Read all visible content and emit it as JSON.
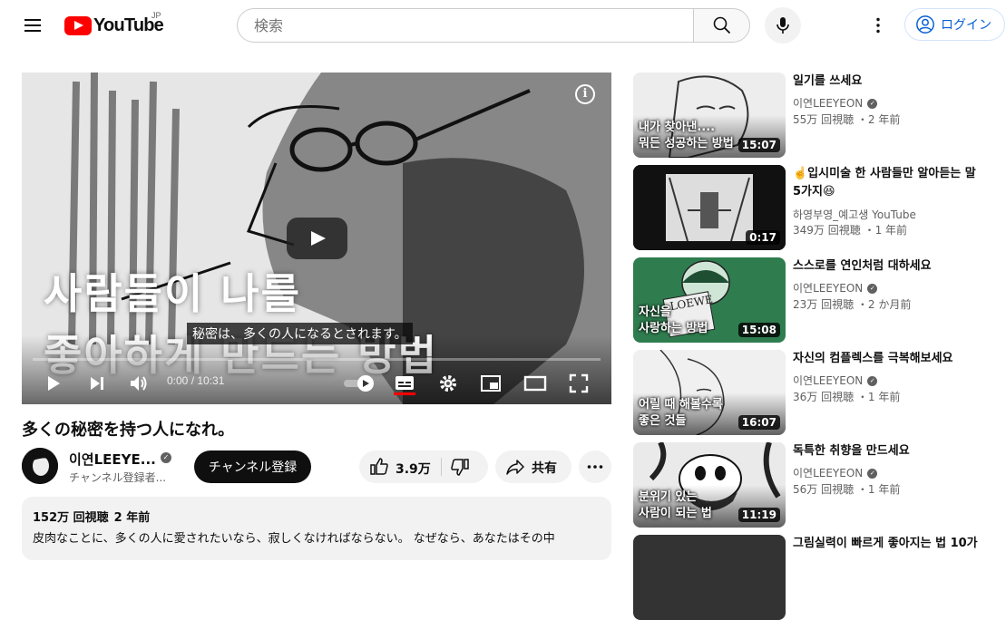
{
  "header": {
    "logo_text": "YouTube",
    "country_code": "JP",
    "search_placeholder": "検索",
    "login_label": "ログイン"
  },
  "player": {
    "title_overlay_line1": "사람들이 나를",
    "title_overlay_line2": "좋아하게 만드는 방법",
    "caption": "秘密は、多くの人になるとされます。",
    "time": "0:00 / 10:31",
    "progress": 0
  },
  "video": {
    "title": "多くの秘密を持つ人になれ。",
    "channel_name": "이연LEEYE...",
    "subscribers": "チャンネル登録者...",
    "subscribe_label": "チャンネル登録",
    "likes": "3.9万",
    "share_label": "共有"
  },
  "description": {
    "views": "152万 回視聴",
    "date": "2 年前",
    "text": "皮肉なことに、多くの人に愛されたいなら、寂しくなければならない。 なぜなら、あなたはその中"
  },
  "recommendations": [
    {
      "title": "일기를 쓰세요",
      "channel": "이연LEEYEON",
      "verified": true,
      "views": "55万 回視聴",
      "age": "2 年前",
      "duration": "15:07",
      "thumb_text_1": "내가 찾아낸....",
      "thumb_text_2": "뭐든 성공하는 방법"
    },
    {
      "title": "☝️입시미술 한 사람들만 알아듣는 말 5가지😆",
      "channel": "하영부영_예고생 YouTube",
      "verified": false,
      "views": "349万 回視聴",
      "age": "1 年前",
      "duration": "0:17",
      "thumb_text_1": "",
      "thumb_text_2": ""
    },
    {
      "title": "스스로를 연인처럼 대하세요",
      "channel": "이연LEEYEON",
      "verified": true,
      "views": "23万 回視聴",
      "age": "2 か月前",
      "duration": "15:08",
      "thumb_text_1": "자신을",
      "thumb_text_2": "사랑하는 방법"
    },
    {
      "title": "자신의 컴플렉스를 극복해보세요",
      "channel": "이연LEEYEON",
      "verified": true,
      "views": "36万 回視聴",
      "age": "1 年前",
      "duration": "16:07",
      "thumb_text_1": "어릴 때 해볼수록",
      "thumb_text_2": "좋은 것들"
    },
    {
      "title": "독특한 취향을 만드세요",
      "channel": "이연LEEYEON",
      "verified": true,
      "views": "56万 回視聴",
      "age": "1 年前",
      "duration": "11:19",
      "thumb_text_1": "분위기 있는",
      "thumb_text_2": "사람이 되는 법"
    },
    {
      "title": "그림실력이 빠르게 좋아지는 법 10가",
      "channel": "",
      "verified": false,
      "views": "",
      "age": "",
      "duration": "",
      "thumb_text_1": "",
      "thumb_text_2": ""
    }
  ]
}
